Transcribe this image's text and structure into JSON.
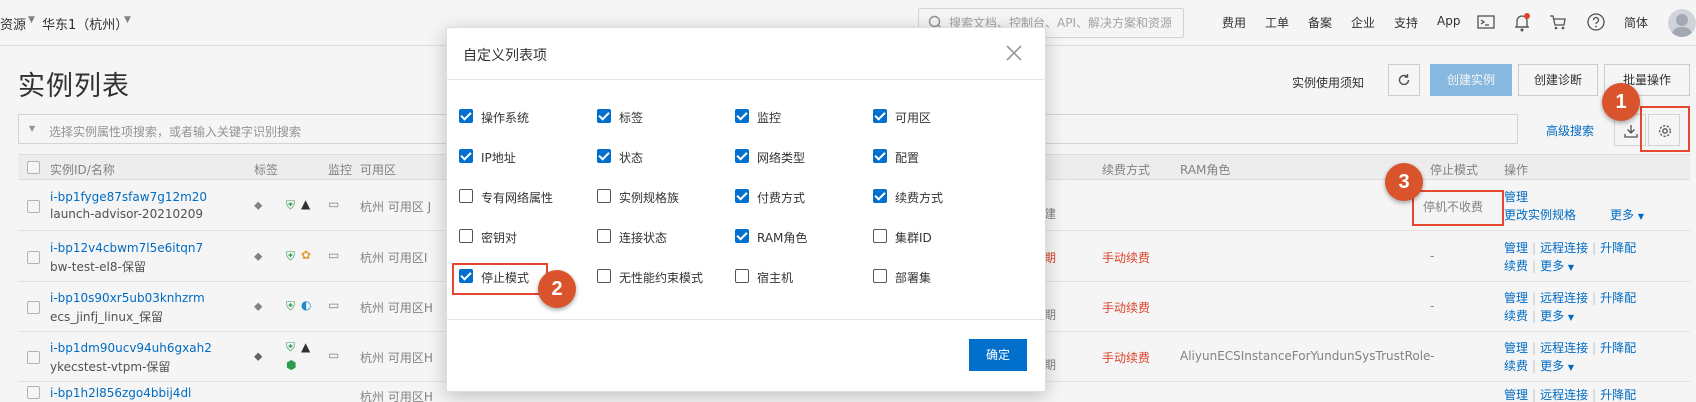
{
  "topbar": {
    "resource": "资源",
    "region": "华东1（杭州）",
    "search_placeholder": "搜索文档、控制台、API、解决方案和资源",
    "nav": [
      "费用",
      "工单",
      "备案",
      "企业",
      "支持",
      "App"
    ],
    "lang": "简体"
  },
  "page": {
    "title": "实例列表",
    "usage_link": "实例使用须知",
    "create_instance": "创建实例",
    "create_diagnosis": "创建诊断",
    "batch_ops": "批量操作",
    "filter_placeholder": "选择实例属性项搜索，或者输入关键字识别搜索",
    "advanced_search": "高级搜索"
  },
  "table": {
    "headers": {
      "id": "实例ID/名称",
      "tags": "标签",
      "monitor": "监控",
      "zone": "可用区",
      "renew": "续费方式",
      "ram": "RAM角色",
      "stop_mode": "停止模式",
      "ops": "操作"
    },
    "rows": [
      {
        "id": "i-bp1fyge87sfaw7g12m20",
        "name": "launch-advisor-20210209",
        "zone": "杭州 可用区 J",
        "billing": "创建",
        "renew": "",
        "ram": "",
        "stop": "停机不收费",
        "ops1": [
          "管理"
        ],
        "ops2": [
          "更改实例规格",
          "更多"
        ]
      },
      {
        "id": "i-bp12v4cbwm7l5e6itqn7",
        "name": "bw-test-el8-保留",
        "zone": "杭州 可用区I",
        "billing": "到期",
        "renew": "手动续费",
        "ram": "",
        "stop": "-",
        "ops1": [
          "管理",
          "远程连接",
          "升降配"
        ],
        "ops2": [
          "续费",
          "更多"
        ]
      },
      {
        "id": "i-bp10s90xr5ub03knhzrm",
        "name": "ecs_jinfj_linux_保留",
        "zone": "杭州 可用区H",
        "billing": "到期",
        "renew": "手动续费",
        "ram": "",
        "stop": "-",
        "ops1": [
          "管理",
          "远程连接",
          "升降配"
        ],
        "ops2": [
          "续费",
          "更多"
        ]
      },
      {
        "id": "i-bp1dm90ucv94uh6gxah2",
        "name": "ykecstest-vtpm-保留",
        "zone": "杭州 可用区H",
        "billing": "到期",
        "renew": "手动续费",
        "ram": "AliyunECSInstanceForYundunSysTrustRole",
        "stop": "-",
        "ops1": [
          "管理",
          "远程连接",
          "升降配"
        ],
        "ops2": [
          "续费",
          "更多"
        ]
      },
      {
        "id": "i-bp1h2l856zgo4bbij4dl",
        "name": "",
        "zone": "杭州 可用区H",
        "billing": "",
        "renew": "",
        "ram": "",
        "stop": "",
        "ops1": [
          "管理",
          "远程连接",
          "升降配"
        ],
        "ops2": []
      }
    ]
  },
  "modal": {
    "title": "自定义列表项",
    "confirm": "确定",
    "options": [
      {
        "label": "操作系统",
        "checked": true
      },
      {
        "label": "标签",
        "checked": true
      },
      {
        "label": "监控",
        "checked": true
      },
      {
        "label": "可用区",
        "checked": true
      },
      {
        "label": "IP地址",
        "checked": true
      },
      {
        "label": "状态",
        "checked": true
      },
      {
        "label": "网络类型",
        "checked": true
      },
      {
        "label": "配置",
        "checked": true
      },
      {
        "label": "专有网络属性",
        "checked": false
      },
      {
        "label": "实例规格族",
        "checked": false
      },
      {
        "label": "付费方式",
        "checked": true
      },
      {
        "label": "续费方式",
        "checked": true
      },
      {
        "label": "密钥对",
        "checked": false
      },
      {
        "label": "连接状态",
        "checked": false
      },
      {
        "label": "RAM角色",
        "checked": true
      },
      {
        "label": "集群ID",
        "checked": false
      },
      {
        "label": "停止模式",
        "checked": true
      },
      {
        "label": "无性能约束模式",
        "checked": false
      },
      {
        "label": "宿主机",
        "checked": false
      },
      {
        "label": "部署集",
        "checked": false
      }
    ]
  },
  "annotations": {
    "badge1": "1",
    "badge2": "2",
    "badge3": "3"
  }
}
